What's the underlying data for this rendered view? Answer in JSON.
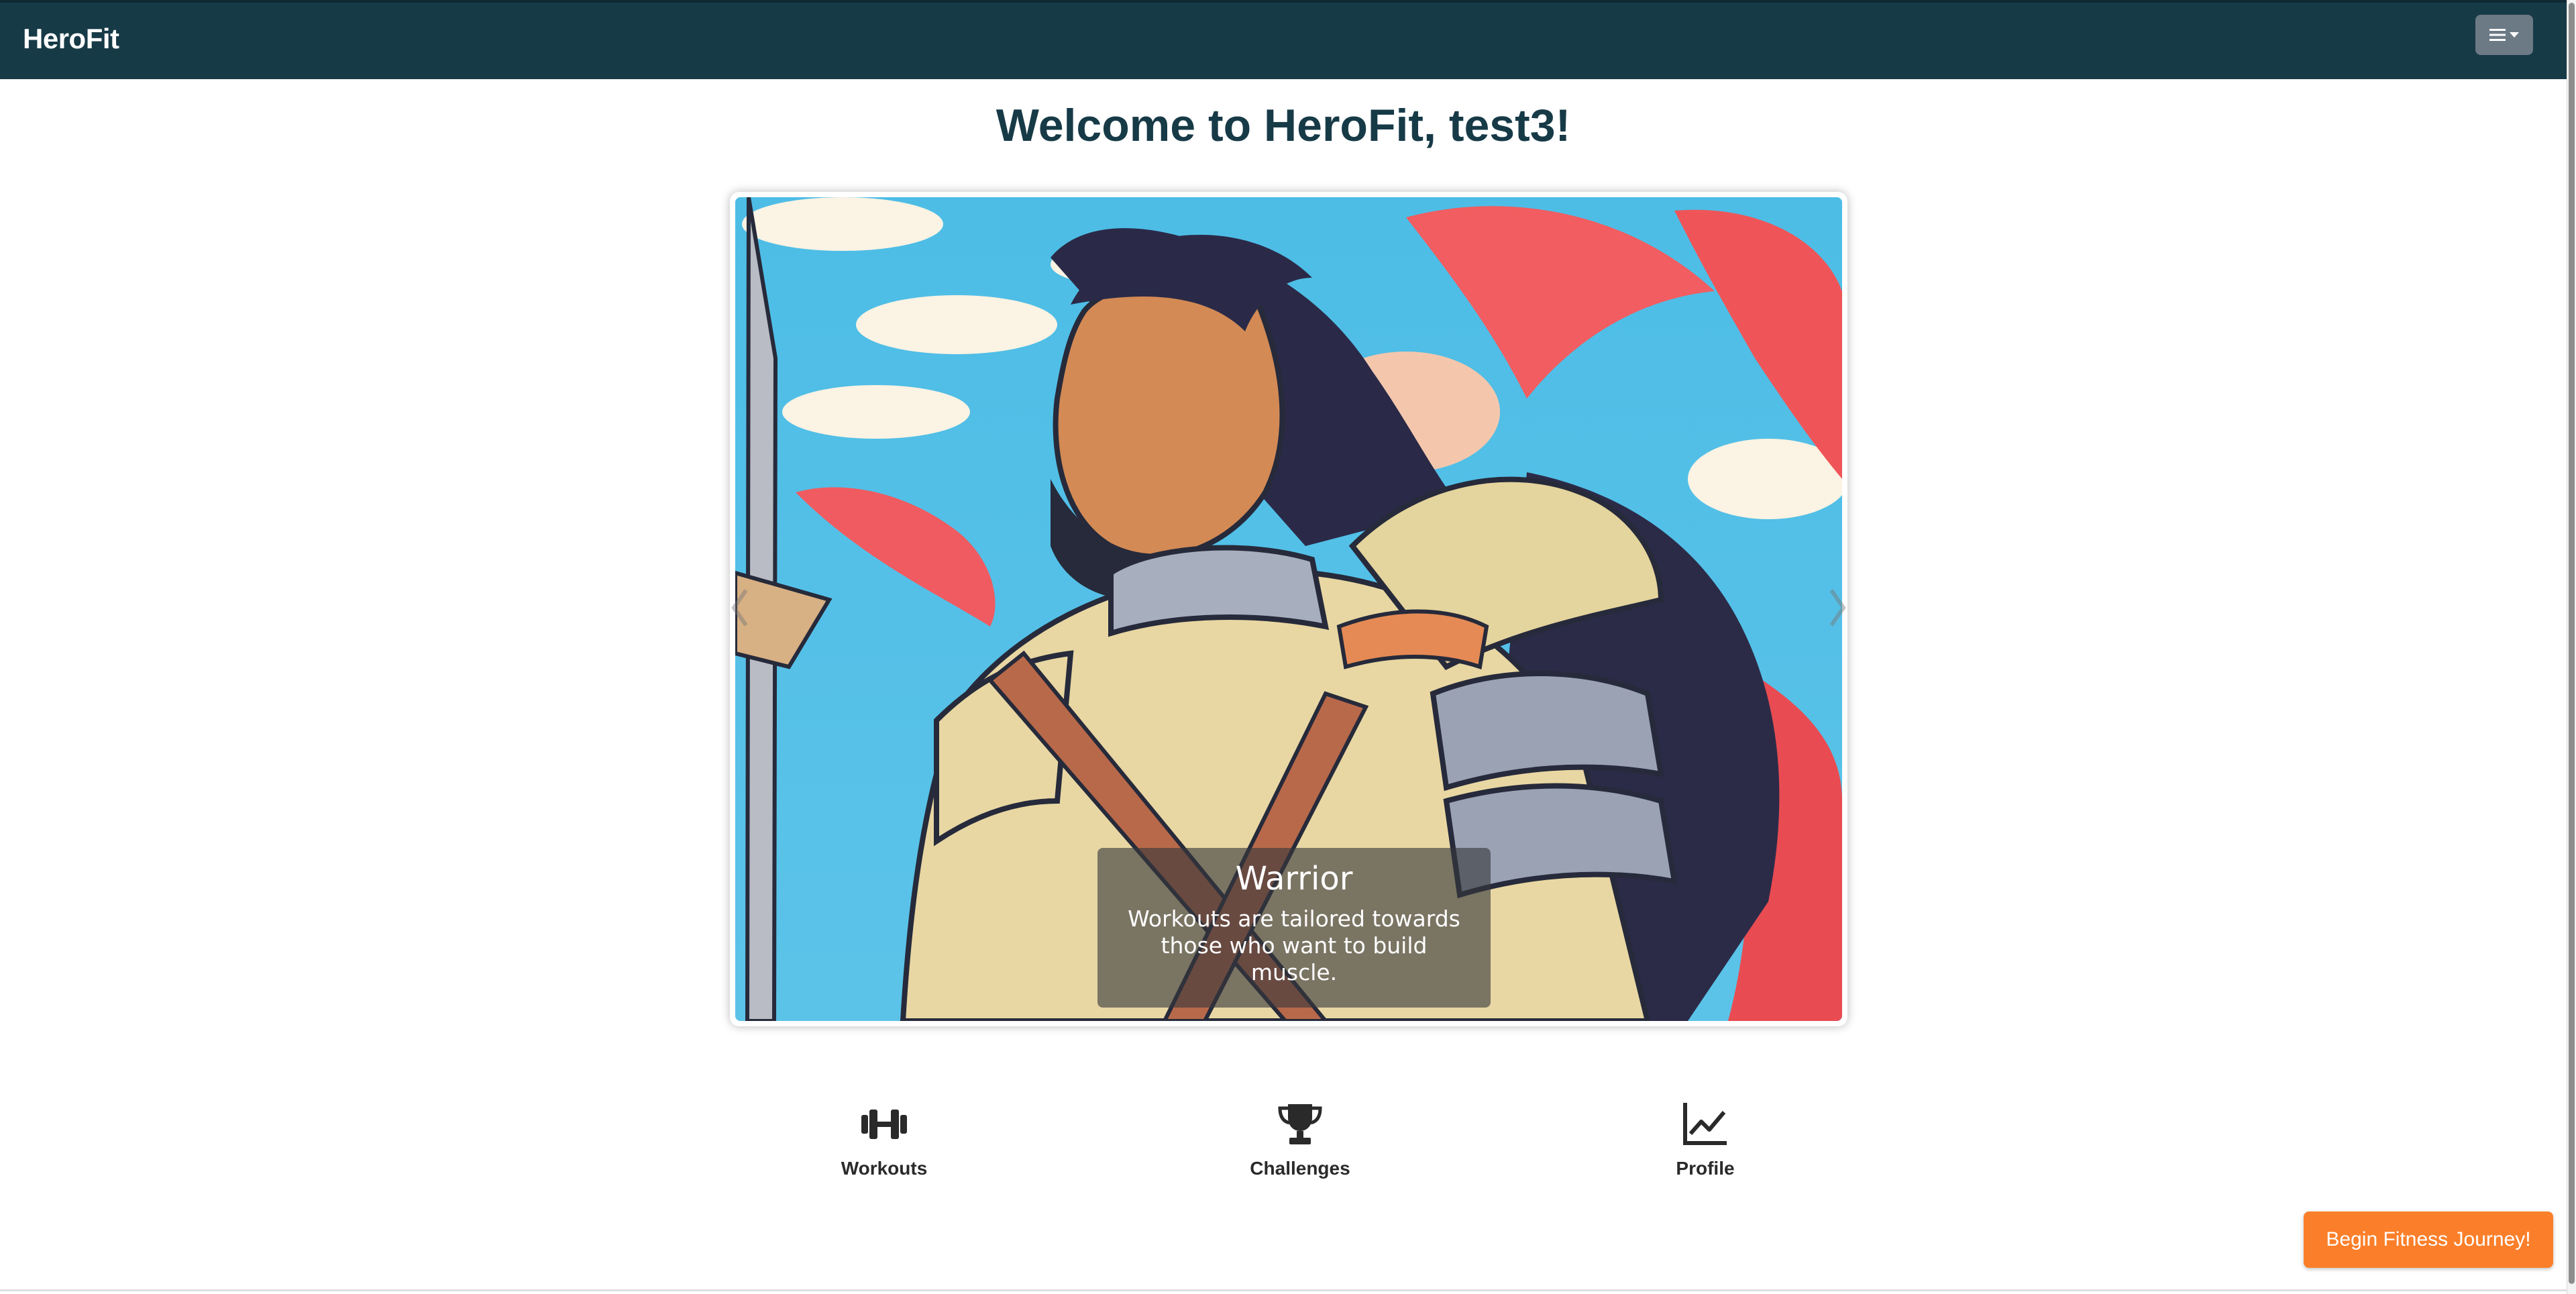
{
  "app": {
    "brand": "HeroFit"
  },
  "header": {
    "menu_icon": "hamburger-menu-icon"
  },
  "main": {
    "welcome_title": "Welcome to HeroFit, test3!",
    "carousel": {
      "slide": {
        "image_subject": "warrior-illustration",
        "caption_title": "Warrior",
        "caption_text": "Workouts are tailored towards those who want to build muscle."
      }
    },
    "quick_links": [
      {
        "label": "Workouts",
        "icon": "dumbbell-icon"
      },
      {
        "label": "Challenges",
        "icon": "trophy-icon"
      },
      {
        "label": "Profile",
        "icon": "chart-line-icon"
      }
    ]
  },
  "cta": {
    "label": "Begin Fitness Journey!"
  },
  "colors": {
    "navbar": "#173a47",
    "title": "#173a47",
    "cta": "#fb7f2a",
    "menu_button": "#6c7a86"
  }
}
